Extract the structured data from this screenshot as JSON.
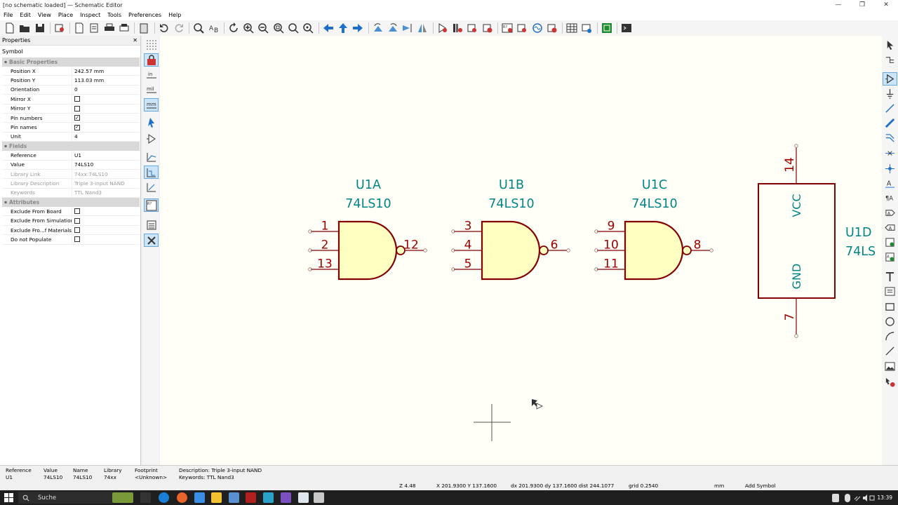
{
  "window": {
    "title": "[no schematic loaded] — Schematic Editor",
    "minimize": "—",
    "maximize": "❐",
    "close": "✕"
  },
  "menu": [
    "File",
    "Edit",
    "View",
    "Place",
    "Inspect",
    "Tools",
    "Preferences",
    "Help"
  ],
  "properties": {
    "title": "Properties",
    "close": "✕",
    "symbol": "Symbol",
    "groups": {
      "basic": "Basic Properties",
      "fields": "Fields",
      "attributes": "Attributes"
    },
    "basic": {
      "position_x": {
        "label": "Position X",
        "value": "242.57 mm"
      },
      "position_y": {
        "label": "Position Y",
        "value": "113.03 mm"
      },
      "orientation": {
        "label": "Orientation",
        "value": "0"
      },
      "mirror_x": {
        "label": "Mirror X",
        "checked": false
      },
      "mirror_y": {
        "label": "Mirror Y",
        "checked": false
      },
      "pin_numbers": {
        "label": "Pin numbers",
        "checked": true
      },
      "pin_names": {
        "label": "Pin names",
        "checked": true
      },
      "unit": {
        "label": "Unit",
        "value": "4"
      }
    },
    "fields": {
      "reference": {
        "label": "Reference",
        "value": "U1"
      },
      "value": {
        "label": "Value",
        "value": "74LS10"
      },
      "library_link": {
        "label": "Library Link",
        "value": "74xx:74LS10"
      },
      "library_description": {
        "label": "Library Description",
        "value": "Triple 3-input NAND"
      },
      "keywords": {
        "label": "Keywords",
        "value": "TTL Nand3"
      }
    },
    "attributes": {
      "exclude_board": {
        "label": "Exclude From Board",
        "checked": false
      },
      "exclude_sim": {
        "label": "Exclude From Simulation",
        "checked": false
      },
      "exclude_bom": {
        "label": "Exclude Fro...f Materials",
        "checked": false
      },
      "dnp": {
        "label": "Do not Populate",
        "checked": false
      }
    }
  },
  "schematic": {
    "gates": [
      {
        "ref": "U1A",
        "value": "74LS10",
        "pins": [
          "1",
          "2",
          "13"
        ],
        "out": "12"
      },
      {
        "ref": "U1B",
        "value": "74LS10",
        "pins": [
          "3",
          "4",
          "5"
        ],
        "out": "6"
      },
      {
        "ref": "U1C",
        "value": "74LS10",
        "pins": [
          "9",
          "10",
          "11"
        ],
        "out": "8"
      }
    ],
    "power_unit": {
      "ref": "U1D",
      "value": "74LS",
      "vcc_label": "VCC",
      "gnd_label": "GND",
      "vcc_pin": "14",
      "gnd_pin": "7"
    },
    "colors": {
      "canvas": "#fffff8",
      "body_fill": "#ffffc2",
      "body_stroke": "#840000",
      "pin_text": "#a00000",
      "field_text": "#008484"
    }
  },
  "message_panel": [
    {
      "label": "Reference",
      "value": "U1"
    },
    {
      "label": "Value",
      "value": "74LS10"
    },
    {
      "label": "Name",
      "value": "74LS10"
    },
    {
      "label": "Library",
      "value": "74xx"
    },
    {
      "label": "Footprint",
      "value": "<Unknown>"
    },
    {
      "label": "Description: Triple 3-input NAND",
      "value": "Keywords: TTL Nand3"
    }
  ],
  "status": {
    "zoom": "Z 4.48",
    "cursor": "X 201.9300  Y 137.1600",
    "delta": "dx 201.9300  dy 137.1600  dist 244.1077",
    "grid": "grid 0.2540",
    "units": "mm",
    "mode": "Add Symbol"
  },
  "taskbar": {
    "search": "Suche",
    "time": "13:39"
  }
}
